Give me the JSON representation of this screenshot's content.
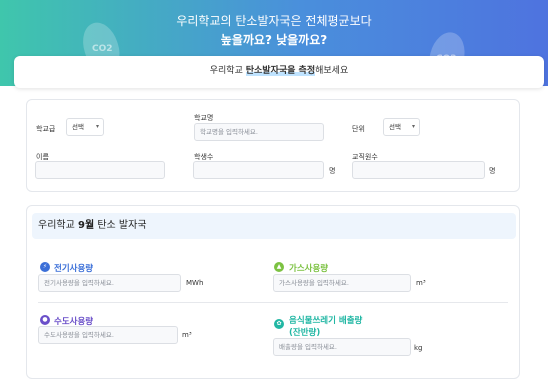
{
  "banner": {
    "line1": "우리학교의 탄소발자국은 전체평균보다",
    "line2": "높을까요? 낮을까요?"
  },
  "measure": {
    "prefix": "우리학교 ",
    "highlight": "탄소발자국을 측정",
    "suffix": "해보세요"
  },
  "school_info": {
    "level_label": "학교급",
    "level_select": "선택",
    "name_label": "학교명",
    "name_placeholder": "학교명을 입력하세요.",
    "unit_label": "단위",
    "unit_select": "선택",
    "person_label": "이름",
    "students_label": "학생수",
    "students_unit": "명",
    "staff_label": "교직원수",
    "staff_unit": "명"
  },
  "footprint": {
    "title_prefix": "우리학교 ",
    "title_month": "9월",
    "title_suffix": " 탄소 발자국",
    "electricity": {
      "label": "전기사용량",
      "placeholder": "전기사용량을 입력하세요.",
      "unit": "MWh"
    },
    "gas": {
      "label": "가스사용량",
      "placeholder": "가스사용량을 입력하세요.",
      "unit": "m³"
    },
    "water": {
      "label": "수도사용량",
      "placeholder": "수도사용량을 입력하세요.",
      "unit": "m³"
    },
    "food_waste": {
      "label_line1": "음식물쓰레기 배출량",
      "label_line2": "(잔반량)",
      "placeholder": "배출량을 입력하세요.",
      "unit": "kg"
    }
  },
  "colors": {
    "electricity": "#3b6fd8",
    "gas": "#7cc242",
    "water": "#6a4fc9",
    "food_waste": "#22b7a4"
  },
  "icons": {
    "decor": "footprint-icon",
    "electricity": "lightning-icon",
    "gas": "flame-icon",
    "water": "droplet-icon",
    "food_waste": "leaf-icon"
  }
}
